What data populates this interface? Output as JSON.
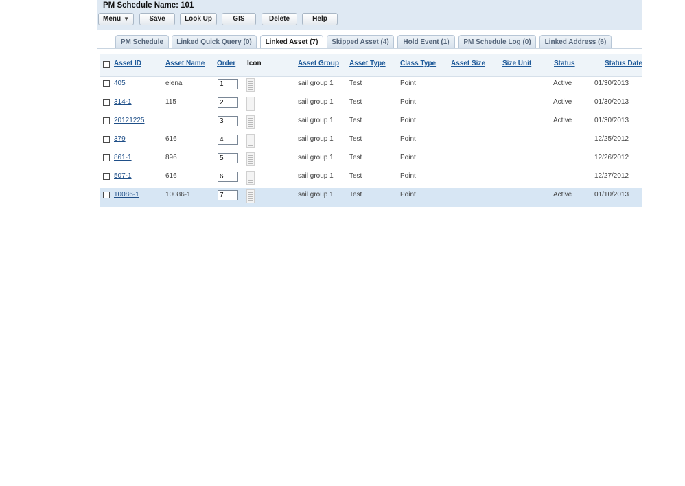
{
  "header": {
    "title": "PM Schedule Name: 101"
  },
  "toolbar": {
    "menu_label": "Menu",
    "save_label": "Save",
    "lookup_label": "Look Up",
    "gis_label": "GIS",
    "delete_label": "Delete",
    "help_label": "Help"
  },
  "tabs": [
    {
      "label": "PM Schedule"
    },
    {
      "label": "Linked Quick Query (0)"
    },
    {
      "label": "Linked Asset (7)"
    },
    {
      "label": "Skipped Asset (4)"
    },
    {
      "label": "Hold Event (1)"
    },
    {
      "label": "PM Schedule Log (0)"
    },
    {
      "label": "Linked Address (6)"
    }
  ],
  "active_tab": "Linked Asset (7)",
  "grid": {
    "columns": {
      "asset_id": "Asset ID",
      "asset_name": "Asset Name",
      "order": "Order",
      "icon": "Icon",
      "asset_group": "Asset Group",
      "asset_type": "Asset Type",
      "class_type": "Class Type",
      "asset_size": "Asset Size",
      "size_unit": "Size Unit",
      "status": "Status",
      "status_date": "Status Date"
    },
    "rows": [
      {
        "asset_id": "405",
        "asset_name": "elena",
        "order": "1",
        "asset_group": "sail group 1",
        "asset_type": "Test",
        "class_type": "Point",
        "asset_size": "",
        "size_unit": "",
        "status": "Active",
        "status_date": "01/30/2013"
      },
      {
        "asset_id": "314-1",
        "asset_name": "115",
        "order": "2",
        "asset_group": "sail group 1",
        "asset_type": "Test",
        "class_type": "Point",
        "asset_size": "",
        "size_unit": "",
        "status": "Active",
        "status_date": "01/30/2013"
      },
      {
        "asset_id": "20121225",
        "asset_name": "",
        "order": "3",
        "asset_group": "sail group 1",
        "asset_type": "Test",
        "class_type": "Point",
        "asset_size": "",
        "size_unit": "",
        "status": "Active",
        "status_date": "01/30/2013"
      },
      {
        "asset_id": "379",
        "asset_name": "616",
        "order": "4",
        "asset_group": "sail group 1",
        "asset_type": "Test",
        "class_type": "Point",
        "asset_size": "",
        "size_unit": "",
        "status": "",
        "status_date": "12/25/2012"
      },
      {
        "asset_id": "861-1",
        "asset_name": "896",
        "order": "5",
        "asset_group": "sail group 1",
        "asset_type": "Test",
        "class_type": "Point",
        "asset_size": "",
        "size_unit": "",
        "status": "",
        "status_date": "12/26/2012"
      },
      {
        "asset_id": "507-1",
        "asset_name": "616",
        "order": "6",
        "asset_group": "sail group 1",
        "asset_type": "Test",
        "class_type": "Point",
        "asset_size": "",
        "size_unit": "",
        "status": "",
        "status_date": "12/27/2012"
      },
      {
        "asset_id": "10086-1",
        "asset_name": "10086-1",
        "order": "7",
        "asset_group": "sail group 1",
        "asset_type": "Test",
        "class_type": "Point",
        "asset_size": "",
        "size_unit": "",
        "status": "Active",
        "status_date": "01/10/2013"
      }
    ],
    "selected_row": 6
  },
  "icons": {
    "menu_caret": "chevron-down-icon",
    "row_icon": "document-icon"
  },
  "colors": {
    "header_bg": "#dfe9f3",
    "link": "#1f5a99",
    "selected_row": "#d7e6f4"
  }
}
